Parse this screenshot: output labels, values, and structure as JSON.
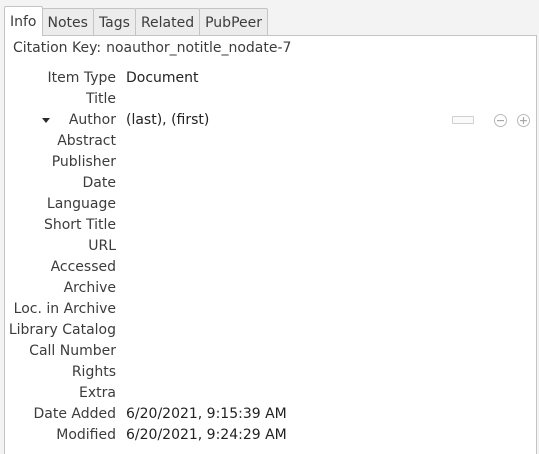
{
  "tabs": [
    {
      "label": "Info",
      "active": true
    },
    {
      "label": "Notes",
      "active": false
    },
    {
      "label": "Tags",
      "active": false
    },
    {
      "label": "Related",
      "active": false
    },
    {
      "label": "PubPeer",
      "active": false
    }
  ],
  "citation": {
    "label": "Citation Key:",
    "value": "noauthor_notitle_nodate-7"
  },
  "fields": [
    {
      "label": "Item Type",
      "value": "Document"
    },
    {
      "label": "Title",
      "value": ""
    },
    {
      "label": "Author",
      "value": "(last), (first)"
    },
    {
      "label": "Abstract",
      "value": ""
    },
    {
      "label": "Publisher",
      "value": ""
    },
    {
      "label": "Date",
      "value": ""
    },
    {
      "label": "Language",
      "value": ""
    },
    {
      "label": "Short Title",
      "value": ""
    },
    {
      "label": "URL",
      "value": ""
    },
    {
      "label": "Accessed",
      "value": ""
    },
    {
      "label": "Archive",
      "value": ""
    },
    {
      "label": "Loc. in Archive",
      "value": ""
    },
    {
      "label": "Library Catalog",
      "value": ""
    },
    {
      "label": "Call Number",
      "value": ""
    },
    {
      "label": "Rights",
      "value": ""
    },
    {
      "label": "Extra",
      "value": ""
    },
    {
      "label": "Date Added",
      "value": "6/20/2021, 9:15:39 AM"
    },
    {
      "label": "Modified",
      "value": "6/20/2021, 9:24:29 AM"
    }
  ],
  "icons": {
    "creator_type": "dropdown-triangle-icon",
    "switch_mode": "switch-field-mode-icon",
    "remove": "minus-circle-icon",
    "add": "plus-circle-icon"
  },
  "colors": {
    "background": "#f3f3f3",
    "panel": "#ffffff",
    "border": "#c4c4c4",
    "text": "#3c3c3c"
  }
}
